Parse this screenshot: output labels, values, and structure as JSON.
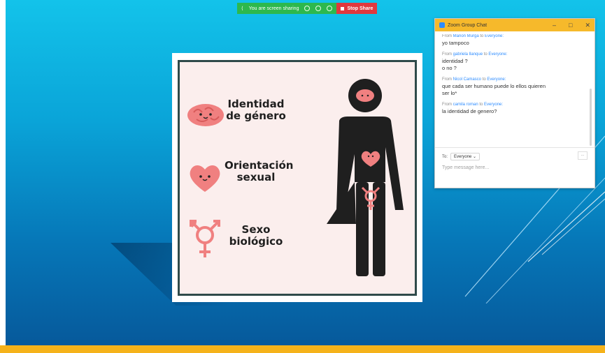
{
  "share_bar": {
    "status": "You are screen sharing",
    "stop_label": "Stop Share"
  },
  "slide": {
    "rows": [
      {
        "label_line1": "Identidad",
        "label_line2": "de género"
      },
      {
        "label_line1": "Orientación",
        "label_line2": "sexual"
      },
      {
        "label_line1": "Sexo",
        "label_line2": "biológico"
      }
    ]
  },
  "chat": {
    "title": "Zoom Group Chat",
    "messages": [
      {
        "from_prefix": "From",
        "sender": "Marion Murga",
        "to_word": "to",
        "recipient": "Everyone:",
        "lines": [
          "yo tampoco"
        ]
      },
      {
        "from_prefix": "From",
        "sender": "gabriela llanque",
        "to_word": "to",
        "recipient": "Everyone:",
        "lines": [
          "identidad ?",
          "o no ?"
        ]
      },
      {
        "from_prefix": "From",
        "sender": "Nicol Camasco",
        "to_word": "to",
        "recipient": "Everyone:",
        "lines": [
          "que cada ser humano puede lo ellos quieren",
          "ser lo*"
        ]
      },
      {
        "from_prefix": "From",
        "sender": "camila roman",
        "to_word": "to",
        "recipient": "Everyone:",
        "lines": [
          "la identidad de genero?"
        ]
      }
    ],
    "to_label": "To:",
    "to_value": "Everyone",
    "more_label": "...",
    "input_placeholder": "Type message here..."
  },
  "colors": {
    "accent": "#f6b92b",
    "pink": "#f08080",
    "dark": "#1f1f1f",
    "green": "#2db84d",
    "red": "#e0383e"
  }
}
